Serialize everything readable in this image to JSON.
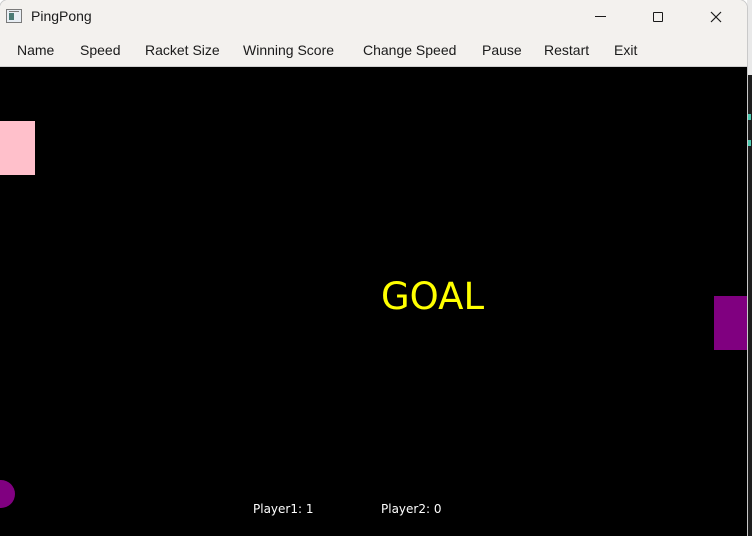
{
  "window": {
    "title": "PingPong",
    "icon": "app-window-icon"
  },
  "menu": [
    {
      "label": "Name"
    },
    {
      "label": "Speed"
    },
    {
      "label": "Racket Size"
    },
    {
      "label": "Winning Score"
    },
    {
      "label": "Change Speed"
    },
    {
      "label": "Pause"
    },
    {
      "label": "Restart"
    },
    {
      "label": "Exit"
    }
  ],
  "game": {
    "message": "GOAL",
    "player1_score": "Player1: 1",
    "player2_score": "Player2: 0",
    "colors": {
      "background": "#000000",
      "left_racket": "#ffc0cb",
      "right_racket": "#800080",
      "ball": "#800080",
      "message": "#ffff00",
      "score_text": "#ffffff"
    }
  }
}
